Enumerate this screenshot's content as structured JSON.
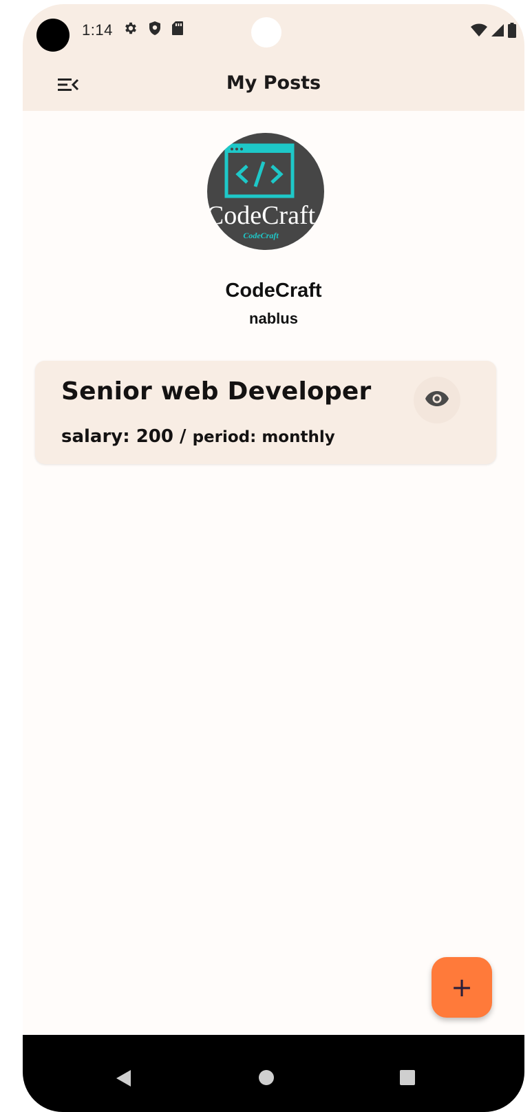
{
  "status_bar": {
    "time": "1:14",
    "left_icons": [
      "settings-icon",
      "shield-icon",
      "sd-card-icon"
    ],
    "right_icons": [
      "wifi-icon",
      "signal-icon",
      "battery-icon"
    ]
  },
  "app_bar": {
    "title": "My Posts",
    "menu_icon": "menu-open-icon"
  },
  "profile": {
    "avatar_logo_text": "CodeCraft",
    "avatar_logo_subtext": "CodeCraft",
    "name": "CodeCraft",
    "city": "nablus"
  },
  "posts": [
    {
      "title": "Senior web Developer",
      "salary_text": "salary: 200 / ",
      "period_text": "period: monthly",
      "action_icon": "eye-icon"
    }
  ],
  "fab": {
    "label": "+",
    "icon": "add-icon",
    "color": "#ff7a3a"
  },
  "theme": {
    "surface": "#f8ede4",
    "background": "#fffcfa",
    "accent": "#ff7a3a",
    "logo_teal": "#1ec8c8"
  },
  "nav_bar": {
    "buttons": [
      "back-icon",
      "home-icon",
      "recents-icon"
    ]
  }
}
